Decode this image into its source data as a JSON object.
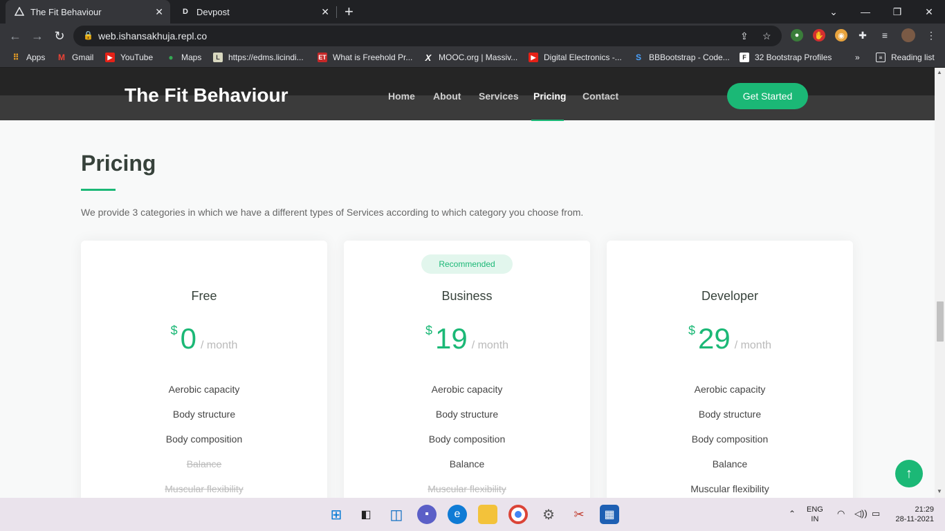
{
  "browser": {
    "tabs": [
      {
        "title": "The Fit Behaviour",
        "active": true
      },
      {
        "title": "Devpost",
        "active": false
      }
    ],
    "url": "web.ishansakhuja.repl.co",
    "bookmarks": [
      {
        "label": "Apps"
      },
      {
        "label": "Gmail"
      },
      {
        "label": "YouTube"
      },
      {
        "label": "Maps"
      },
      {
        "label": "https://edms.licindi..."
      },
      {
        "label": "What is Freehold Pr..."
      },
      {
        "label": "MOOC.org | Massiv..."
      },
      {
        "label": "Digital Electronics -..."
      },
      {
        "label": "BBBootstrap - Code..."
      },
      {
        "label": "32 Bootstrap Profiles"
      }
    ],
    "bookmarks_more": "»",
    "reading_list": "Reading list"
  },
  "site": {
    "logo": "The Fit Behaviour",
    "nav": [
      "Home",
      "About",
      "Services",
      "Pricing",
      "Contact"
    ],
    "active_nav": "Pricing",
    "cta": "Get Started",
    "accent": "#1bb876"
  },
  "pricing": {
    "title": "Pricing",
    "description": "We provide 3 categories in which we have a different types of Services according to which category you choose from.",
    "recommended_label": "Recommended",
    "currency": "$",
    "period": "/ month",
    "plans": [
      {
        "name": "Free",
        "price": "0",
        "features": [
          {
            "label": "Aerobic capacity",
            "included": true
          },
          {
            "label": "Body structure",
            "included": true
          },
          {
            "label": "Body composition",
            "included": true
          },
          {
            "label": "Balance",
            "included": false
          },
          {
            "label": "Muscular flexibility",
            "included": false
          }
        ]
      },
      {
        "name": "Business",
        "price": "19",
        "recommended": true,
        "features": [
          {
            "label": "Aerobic capacity",
            "included": true
          },
          {
            "label": "Body structure",
            "included": true
          },
          {
            "label": "Body composition",
            "included": true
          },
          {
            "label": "Balance",
            "included": true
          },
          {
            "label": "Muscular flexibility",
            "included": false
          }
        ]
      },
      {
        "name": "Developer",
        "price": "29",
        "features": [
          {
            "label": "Aerobic capacity",
            "included": true
          },
          {
            "label": "Body structure",
            "included": true
          },
          {
            "label": "Body composition",
            "included": true
          },
          {
            "label": "Balance",
            "included": true
          },
          {
            "label": "Muscular flexibility",
            "included": true
          }
        ]
      }
    ]
  },
  "taskbar": {
    "lang": "ENG",
    "region": "IN",
    "time": "21:29",
    "date": "28-11-2021"
  }
}
